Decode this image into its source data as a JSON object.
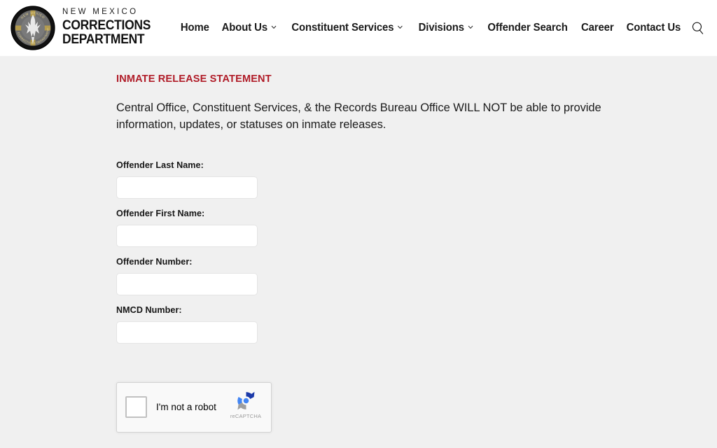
{
  "header": {
    "logo": {
      "icon": "nm-corrections-seal",
      "line1": "NEW MEXICO",
      "line2": "CORRECTIONS",
      "line3": "DEPARTMENT"
    },
    "nav": [
      {
        "label": "Home",
        "has_dropdown": false
      },
      {
        "label": "About Us",
        "has_dropdown": true
      },
      {
        "label": "Constituent Services",
        "has_dropdown": true
      },
      {
        "label": "Divisions",
        "has_dropdown": true
      },
      {
        "label": "Offender Search",
        "has_dropdown": false
      },
      {
        "label": "Career",
        "has_dropdown": false
      },
      {
        "label": "Contact Us",
        "has_dropdown": false
      }
    ],
    "search_icon": "search-icon"
  },
  "main": {
    "title": "INMATE RELEASE STATEMENT",
    "title_color": "#b01c28",
    "paragraph": "Central Office, Constituent Services, & the Records Bureau Office WILL NOT be able to provide information, updates, or statuses on inmate releases.",
    "fields": [
      {
        "label": "Offender Last Name:",
        "value": "",
        "placeholder": ""
      },
      {
        "label": "Offender First Name:",
        "value": "",
        "placeholder": ""
      },
      {
        "label": "Offender Number:",
        "value": "",
        "placeholder": ""
      },
      {
        "label": "NMCD Number:",
        "value": "",
        "placeholder": ""
      }
    ],
    "recaptcha": {
      "label": "I'm not a robot",
      "brand": "reCAPTCHA",
      "checked": false,
      "logo_icon": "recaptcha-logo-icon"
    }
  },
  "colors": {
    "page_background": "#f0f0f0",
    "header_background": "#ffffff",
    "accent_red": "#b01c28",
    "text": "#1a1a1a"
  }
}
